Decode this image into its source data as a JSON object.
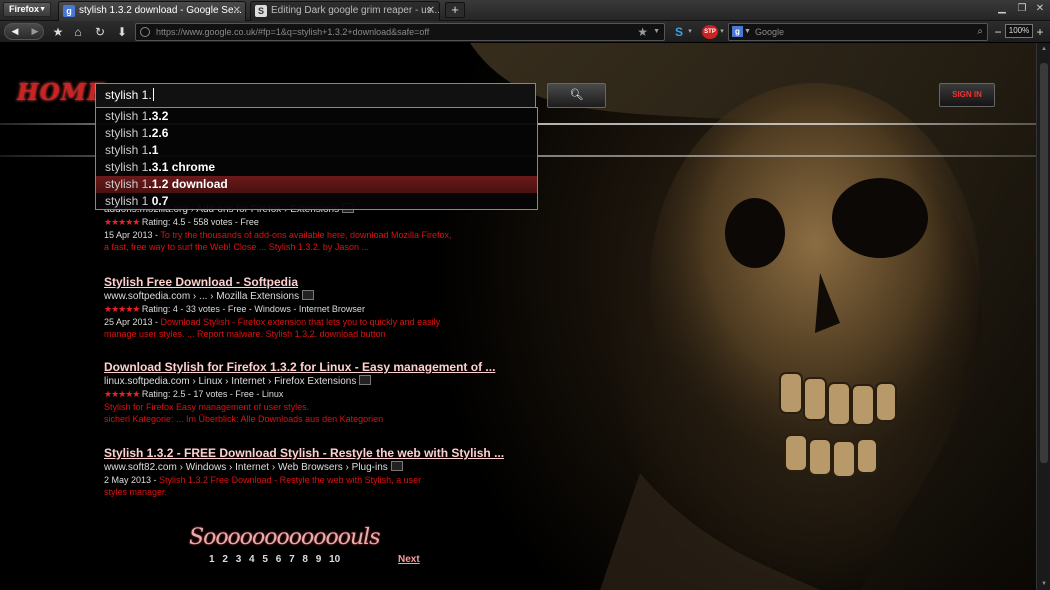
{
  "browser": {
    "menu_label": "Firefox",
    "tabs": [
      {
        "title": "stylish 1.3.2 download - Google Se...",
        "favicon": "g-icon"
      },
      {
        "title": "Editing Dark google grim reaper - us...",
        "favicon": "s-icon"
      }
    ],
    "new_tab": "+",
    "url": "https://www.google.co.uk/#fp=1&q=stylish+1.3.2+download&safe=off",
    "search_placeholder": "Google",
    "zoom": "100%"
  },
  "page": {
    "logo": "HOME",
    "query": "stylish 1.",
    "sign_in": "SIGN IN",
    "suggestions": [
      {
        "prefix": "stylish 1",
        "bold": ".3.2",
        "selected": false
      },
      {
        "prefix": "stylish 1",
        "bold": ".2.6",
        "selected": false
      },
      {
        "prefix": "stylish 1",
        "bold": ".1",
        "selected": false
      },
      {
        "prefix": "stylish 1",
        "bold": ".3.1 chrome",
        "selected": false
      },
      {
        "prefix": "stylish 1",
        "bold": ".1.2 download",
        "selected": true
      },
      {
        "prefix": "stylish 1",
        "bold": " 0.7",
        "selected": false
      }
    ],
    "results": [
      {
        "title": "",
        "url": "addons.mozilla.org › Add-ons for Firefox › Extensions",
        "rating": "Rating: 4.5 - 558 votes - Free",
        "stars": "★★★★★",
        "date": "15 Apr 2013 - ",
        "snippet_lines": [
          "To try the thousands of add-ons available here, download Mozilla Firefox,",
          "a fast, free way to surf the Web! Close ... Stylish 1.3.2. by Jason ..."
        ]
      },
      {
        "title": "Stylish Free Download - Softpedia",
        "url": "www.softpedia.com › ... › Mozilla Extensions",
        "rating": "Rating: 4 - 33 votes - Free - Windows - Internet Browser",
        "stars": "★★★★★",
        "date": "25 Apr 2013 - ",
        "snippet_lines": [
          "Download Stylish - Firefox extension that lets you to quickly and easily",
          "manage user styles. ... Report malware. Stylish 1.3.2. download button"
        ]
      },
      {
        "title": "Download Stylish for Firefox 1.3.2 for Linux - Easy management of ...",
        "url": "linux.softpedia.com › Linux › Internet › Firefox Extensions",
        "rating": "Rating: 2.5 - 17 votes - Free - Linux",
        "stars": "★★★★★",
        "date": "",
        "snippet_lines": [
          "Stylish for Firefox Easy management of user styles.",
          "sicherl Kategorie: ... Im Überblick: Alle Downloads aus den Kategorien"
        ]
      },
      {
        "title": "Stylish 1.3.2 - FREE Download Stylish - Restyle the web with Stylish ...",
        "url": "www.soft82.com › Windows › Internet › Web Browsers › Plug-ins",
        "rating": "",
        "stars": "",
        "date": "2 May 2013 - ",
        "snippet_lines": [
          "Stylish 1.3.2 Free Download - Restyle the web with Stylish, a user",
          "styles manager."
        ]
      }
    ],
    "pager_logo": "Soooooooooooouls",
    "pages": [
      "1",
      "2",
      "3",
      "4",
      "5",
      "6",
      "7",
      "8",
      "9",
      "10"
    ],
    "next": "Next"
  }
}
